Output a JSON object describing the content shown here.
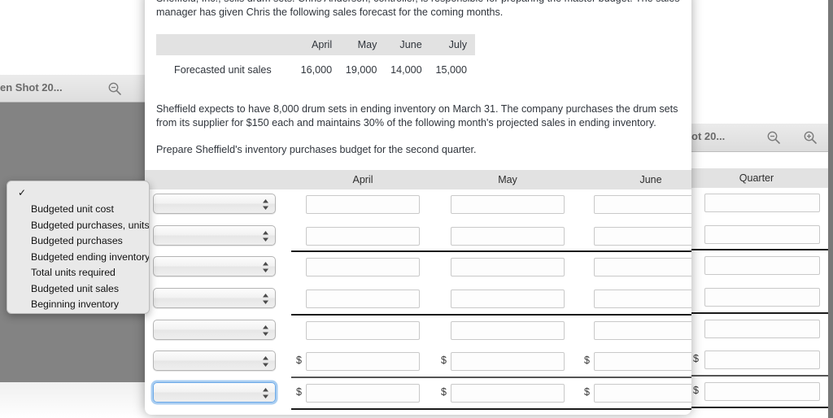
{
  "back_left_window": {
    "title": "en Shot 20...",
    "zoom_out_icon": "magnifier-minus-icon"
  },
  "back_right_window": {
    "title": "ot 20...",
    "zoom_out_icon": "magnifier-minus-icon",
    "zoom_in_icon": "magnifier-plus-icon",
    "quarter_header": "Quarter",
    "quarter_rows": [
      {
        "dollar": "",
        "value": ""
      },
      {
        "dollar": "",
        "value": ""
      },
      {
        "dollar": "",
        "value": ""
      },
      {
        "dollar": "",
        "value": ""
      },
      {
        "dollar": "",
        "value": ""
      },
      {
        "dollar": "$",
        "value": ""
      },
      {
        "dollar": "$",
        "value": ""
      }
    ]
  },
  "problem": {
    "paragraph_1": "Sheffield, Inc., sells drum sets. Chris Anderson, controller, is responsible for preparing the master budget. The sales manager has given Chris the following sales forecast for the coming months.",
    "paragraph_2": "Sheffield expects to have 8,000 drum sets in ending inventory on March 31. The company purchases the drum sets from its supplier for $150 each and maintains 30% of the following month's projected sales in ending inventory.",
    "paragraph_3": "Prepare Sheffield's inventory purchases budget for the second quarter."
  },
  "forecast_table": {
    "row_label_header": "",
    "columns": [
      "April",
      "May",
      "June",
      "July"
    ],
    "row_label": "Forecasted unit sales",
    "values": [
      "16,000",
      "19,000",
      "14,000",
      "15,000"
    ]
  },
  "budget_grid": {
    "headers": [
      "April",
      "May",
      "June"
    ],
    "rows": [
      {
        "select_value": "",
        "april": "",
        "may": "",
        "june": "",
        "dollar": false,
        "focused": false,
        "separator": "none"
      },
      {
        "select_value": "",
        "april": "",
        "may": "",
        "june": "",
        "dollar": false,
        "focused": false,
        "separator": "black"
      },
      {
        "select_value": "",
        "april": "",
        "may": "",
        "june": "",
        "dollar": false,
        "focused": false,
        "separator": "none"
      },
      {
        "select_value": "",
        "april": "",
        "may": "",
        "june": "",
        "dollar": false,
        "focused": false,
        "separator": "black"
      },
      {
        "select_value": "",
        "april": "",
        "may": "",
        "june": "",
        "dollar": false,
        "focused": false,
        "separator": "none"
      },
      {
        "select_value": "",
        "april": "",
        "may": "",
        "june": "",
        "dollar": true,
        "focused": false,
        "separator": "grey"
      },
      {
        "select_value": "",
        "april": "",
        "may": "",
        "june": "",
        "dollar": true,
        "focused": true,
        "separator": "black"
      }
    ],
    "dollar_sign": "$"
  },
  "dropdown_menu": {
    "checkmark": "✓",
    "selected_label": "",
    "items": [
      "Budgeted unit cost",
      "Budgeted purchases, units",
      "Budgeted purchases",
      "Budgeted ending inventory",
      "Total units required",
      "Budgeted unit sales",
      "Beginning inventory"
    ]
  },
  "colors": {
    "table_header_bg": "#e2e2e2",
    "desktop_gray": "#838383",
    "focus_blue": "#6aa8e8",
    "text": "#30353c",
    "scrollbar": "#787878"
  }
}
